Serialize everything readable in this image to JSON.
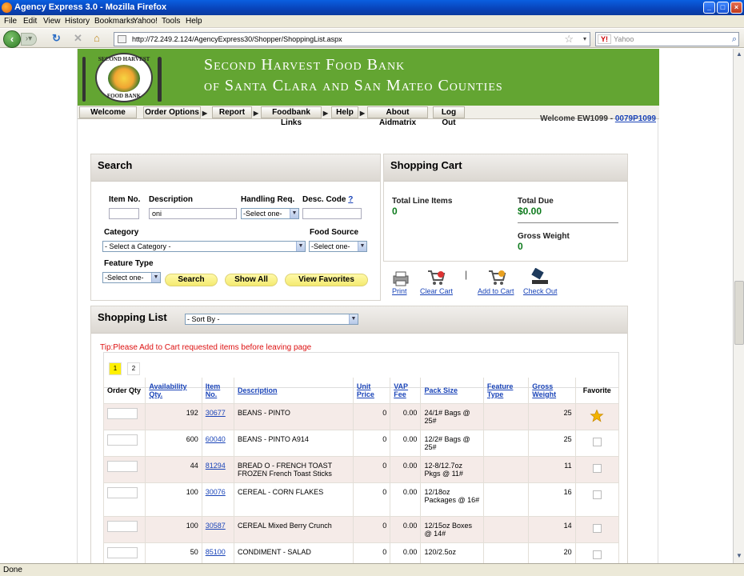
{
  "window": {
    "title": "Agency Express 3.0 - Mozilla Firefox"
  },
  "menu": [
    "File",
    "Edit",
    "View",
    "History",
    "Bookmarks",
    "Yahoo!",
    "Tools",
    "Help"
  ],
  "nav": {
    "url": "http://72.249.2.124/AgencyExpress30/Shopper/ShoppingList.aspx",
    "search_placeholder": "Yahoo",
    "search_engine": "Y!"
  },
  "banner": {
    "line1": "Second Harvest Food Bank",
    "line2": "of Santa Clara and San Mateo Counties",
    "logo_text_top": "SECOND HARVEST",
    "logo_text_bottom": "FOOD BANK"
  },
  "topnav": {
    "items": [
      "Welcome",
      "Order Options",
      "Report",
      "Foodbank Links",
      "Help",
      "About Aidmatrix",
      "Log Out"
    ],
    "welcome_text": "Welcome EW1099 - ",
    "account_link": "0079P1099"
  },
  "search": {
    "title": "Search",
    "item_no_label": "Item No.",
    "description_label": "Description",
    "description_value": "oni",
    "handling_label": "Handling Req.",
    "handling_value": "-Select one-",
    "desc_code_label": "Desc. Code",
    "desc_code_help": "?",
    "category_label": "Category",
    "category_value": "- Select a Category -",
    "food_source_label": "Food Source",
    "food_source_value": "-Select one-",
    "feature_type_label": "Feature Type",
    "feature_type_value": "-Select one-",
    "btn_search": "Search",
    "btn_show_all": "Show All",
    "btn_view_favorites": "View Favorites"
  },
  "cart": {
    "title": "Shopping Cart",
    "total_line_items_label": "Total Line Items",
    "total_line_items": "0",
    "total_due_label": "Total Due",
    "total_due": "$0.00",
    "gross_weight_label": "Gross Weight",
    "gross_weight": "0",
    "tools": {
      "print": "Print",
      "clear_cart": "Clear Cart",
      "add_to_cart": "Add to Cart",
      "check_out": "Check Out"
    },
    "separator": "|"
  },
  "list": {
    "title": "Shopping List",
    "sort_value": "- Sort By -",
    "tip": "Tip:Please Add to Cart requested items before leaving page",
    "pages": [
      "1",
      "2"
    ],
    "headers": {
      "order_qty": "Order Qty",
      "availability": "Availability Qty.",
      "item_no": "Item No.",
      "description": "Description",
      "unit_price": "Unit Price",
      "vap_fee": "VAP Fee",
      "pack_size": "Pack Size",
      "feature_type": "Feature Type",
      "gross_weight": "Gross Weight",
      "favorite": "Favorite"
    },
    "rows": [
      {
        "avail": "192",
        "item": "30677",
        "desc": "BEANS - PINTO",
        "price": "0",
        "vap": "0.00",
        "pack": "24/1# Bags @ 25#",
        "feature": "",
        "weight": "25",
        "favorite": true
      },
      {
        "avail": "600",
        "item": "60040",
        "desc": "BEANS - PINTO A914",
        "price": "0",
        "vap": "0.00",
        "pack": "12/2# Bags @ 25#",
        "feature": "",
        "weight": "25",
        "favorite": false
      },
      {
        "avail": "44",
        "item": "81294",
        "desc": "BREAD O - FRENCH TOAST FROZEN French Toast Sticks",
        "price": "0",
        "vap": "0.00",
        "pack": "12-8/12.7oz Pkgs @ 11#",
        "feature": "",
        "weight": "11",
        "favorite": false
      },
      {
        "avail": "100",
        "item": "30076",
        "desc": "CEREAL - CORN FLAKES",
        "price": "0",
        "vap": "0.00",
        "pack": "12/18oz Packages @ 16#",
        "feature": "",
        "weight": "16",
        "favorite": false
      },
      {
        "avail": "100",
        "item": "30587",
        "desc": "CEREAL Mixed Berry Crunch",
        "price": "0",
        "vap": "0.00",
        "pack": "12/15oz Boxes @ 14#",
        "feature": "",
        "weight": "14",
        "favorite": false
      },
      {
        "avail": "50",
        "item": "85100",
        "desc": "CONDIMENT - SALAD",
        "price": "0",
        "vap": "0.00",
        "pack": "120/2.5oz",
        "feature": "",
        "weight": "20",
        "favorite": false
      }
    ]
  },
  "status": "Done",
  "colors": {
    "banner_green": "#63a532",
    "cart_value_green": "#0d7a1c",
    "link_blue": "#1a44b8",
    "tip_red": "#d11111",
    "row_shade": "#f5ebe8"
  }
}
